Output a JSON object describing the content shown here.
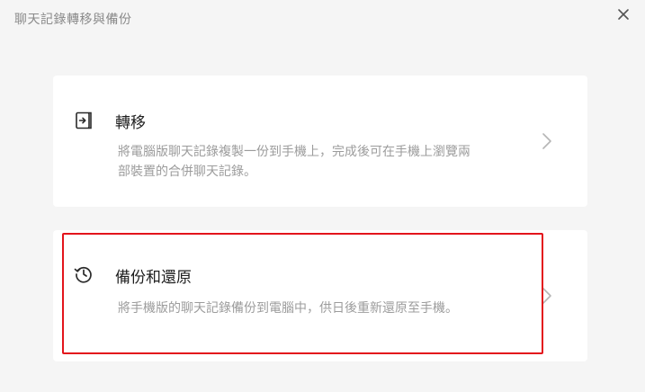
{
  "dialog": {
    "title": "聊天記錄轉移與備份",
    "close_icon": "close-icon"
  },
  "options": [
    {
      "icon": "transfer-icon",
      "title": "轉移",
      "description": "將電腦版聊天記錄複製一份到手機上，完成後可在手機上瀏覽兩部裝置的合併聊天記錄。",
      "chevron_icon": "chevron-right-icon"
    },
    {
      "icon": "history-restore-icon",
      "title": "備份和還原",
      "description": "將手機版的聊天記錄備份到電腦中，供日後重新還原至手機。",
      "chevron_icon": "chevron-right-icon"
    }
  ],
  "colors": {
    "background": "#f5f5f5",
    "card": "#ffffff",
    "highlight_border": "#e3141c",
    "muted_text": "#9c9c9c"
  }
}
